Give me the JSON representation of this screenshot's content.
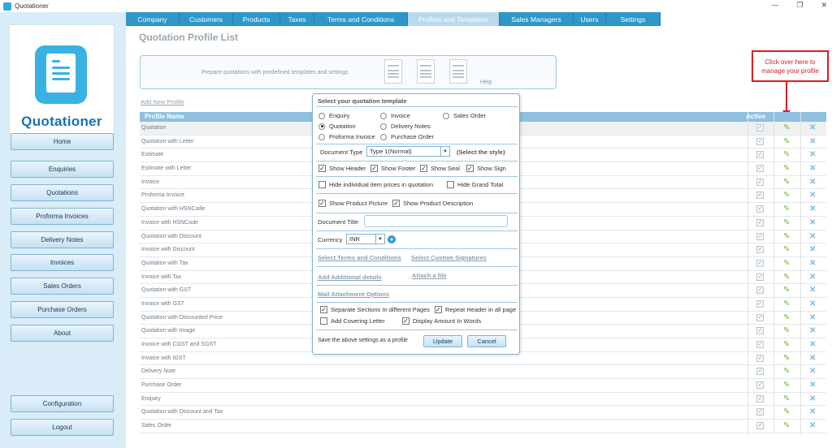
{
  "window": {
    "title": "Quotationer",
    "controls": [
      "—",
      "❐",
      "✕"
    ]
  },
  "logo": {
    "text": "Quotationer"
  },
  "sidebar": {
    "items": [
      "Home",
      "Enquiries",
      "Quotations",
      "Proforma Invoices",
      "Delivery Notes",
      "Invoices",
      "Sales Orders",
      "Purchase Orders",
      "About"
    ],
    "bottom": [
      "Configuration",
      "Logout"
    ]
  },
  "tabs": [
    {
      "label": "Company"
    },
    {
      "label": "Customers"
    },
    {
      "label": "Products"
    },
    {
      "label": "Taxes"
    },
    {
      "label": "Terms and Conditions"
    },
    {
      "label": "Profiles and Templates",
      "active": true
    },
    {
      "label": "Sales Managers"
    },
    {
      "label": "Users"
    },
    {
      "label": "Settings"
    }
  ],
  "page_title": "Quotation Profile List",
  "banner": {
    "text": "Prepare quotations with predefined templates and settings",
    "help": "Help"
  },
  "callout": {
    "line1": "Click over here to",
    "line2": "manage your profile",
    "color": "#e01b1b"
  },
  "add_profile": "Add New Profile",
  "table": {
    "col_name": "Profile Name",
    "col_active": "Active",
    "rows": [
      "Quotation",
      "Quotation with Letter",
      "Estimate",
      "Estimate with Letter",
      "Invoice",
      "Proforma Invoice",
      "Quotation with HSNCode",
      "Invoice with HSNCode",
      "Quotation with Discount",
      "Invoice with Discount",
      "Quotation with Tax",
      "Invoice with Tax",
      "Quotation with GST",
      "Invoice with GST",
      "Quotation with Discounted Price",
      "Quotation with Image",
      "Invoice with CGST and SGST",
      "Invoice with IGST",
      "Delivery Note",
      "Purchase Order",
      "Enquiry",
      "Quotation with Discount and Tax",
      "Sales Order"
    ]
  },
  "popup": {
    "header": "Select your quotation template",
    "radios": [
      {
        "label": "Enquiry",
        "checked": false
      },
      {
        "label": "Invoice",
        "checked": false
      },
      {
        "label": "Sales Order",
        "checked": false
      },
      {
        "label": "Quotation",
        "checked": true
      },
      {
        "label": "Delivery Notes",
        "checked": false
      },
      {
        "label": "Proforma Invoice",
        "checked": false
      },
      {
        "label": "Purchase Order",
        "checked": false
      }
    ],
    "doc_type_label": "Document Type",
    "doc_type_value": "Type 1(Normal)",
    "select_style": "(Select the style)",
    "checks_row1": [
      {
        "label": "Show Header",
        "checked": true
      },
      {
        "label": "Show Footer",
        "checked": true
      },
      {
        "label": "Show Seal",
        "checked": true
      },
      {
        "label": "Show Sign",
        "checked": true
      }
    ],
    "hide_prices": {
      "label": "Hide individual item prices in quotation",
      "checked": false
    },
    "hide_grand": {
      "label": "Hide Grand Total",
      "checked": false
    },
    "show_picture": {
      "label": "Show Product Picture",
      "checked": true
    },
    "show_desc": {
      "label": "Show Product Description",
      "checked": true
    },
    "doc_title_label": "Document Title",
    "doc_title_value": "",
    "currency_label": "Currency",
    "currency_value": "INR",
    "link_terms": "Select Terms and Conditions",
    "link_signatures": "Select Custom Signatures",
    "link_additional": "Add Additional details",
    "link_attach": "Attach a file",
    "mail_options": "Mail Attachment Options",
    "separate_sections": {
      "label": "Separate Sections In different Pages",
      "checked": true
    },
    "repeat_header": {
      "label": "Repeat Header in all page",
      "checked": true
    },
    "covering_letter": {
      "label": "Add Covering Letter",
      "checked": false
    },
    "display_words": {
      "label": "Display Amount In Words",
      "checked": true
    },
    "save_text": "Save the above settings as a profile",
    "update": "Update",
    "cancel": "Cancel"
  }
}
